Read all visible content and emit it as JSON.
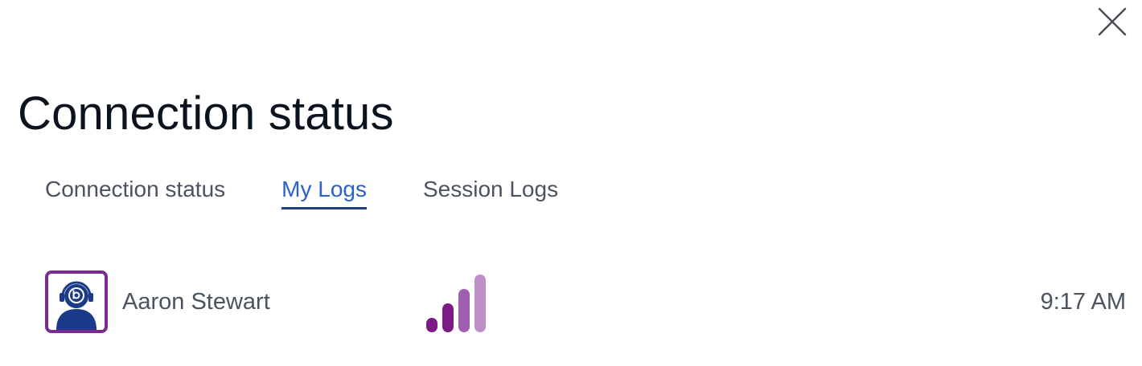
{
  "dialog": {
    "close_icon": "close-icon",
    "title": "Connection status"
  },
  "tabs": [
    {
      "label": "Connection status",
      "active": false
    },
    {
      "label": "My Logs",
      "active": true
    },
    {
      "label": "Session Logs",
      "active": false
    }
  ],
  "log_entry": {
    "avatar_icon": "user-headset-avatar-icon",
    "user_name": "Aaron Stewart",
    "signal_icon": "signal-strength-icon",
    "signal_level_bars": 4,
    "signal_total_bars": 4,
    "time": "9:17 AM"
  },
  "colors": {
    "accent_tab": "#2b62c7",
    "tab_underline": "#1f3f78",
    "avatar_border": "#7a2b92",
    "avatar_figure": "#1b3a8a",
    "signal_strong": "#7b1c86",
    "signal_mid": "#a15fb0",
    "signal_light": "#bf8fc8"
  }
}
